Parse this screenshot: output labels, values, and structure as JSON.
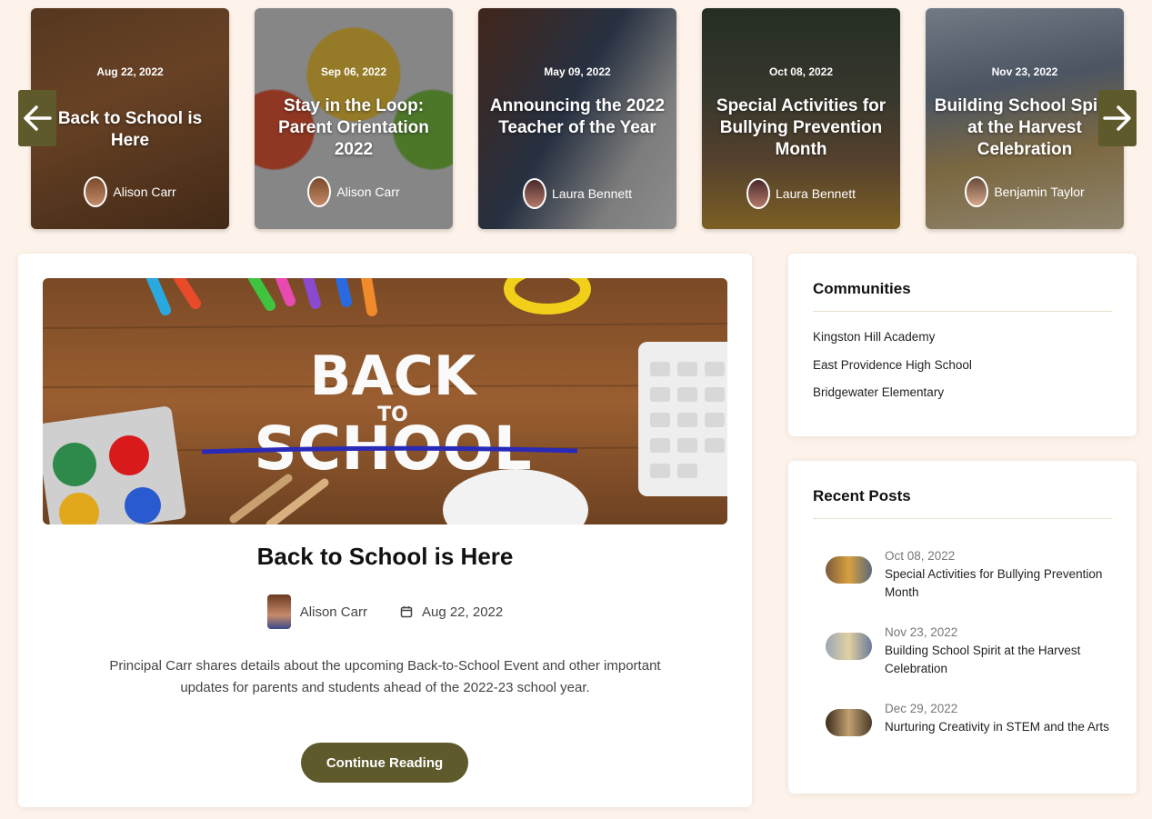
{
  "carousel": {
    "prev_icon": "arrow-left-icon",
    "next_icon": "arrow-right-icon",
    "cards": [
      {
        "date": "Aug 22, 2022",
        "title": "Back to School is Here",
        "author": "Alison Carr"
      },
      {
        "date": "Sep 06, 2022",
        "title": "Stay in the Loop: Parent Orientation 2022",
        "author": "Alison Carr"
      },
      {
        "date": "May 09, 2022",
        "title": "Announcing the 2022 Teacher of the Year",
        "author": "Laura Bennett"
      },
      {
        "date": "Oct 08, 2022",
        "title": "Special Activities for Bullying Prevention Month",
        "author": "Laura Bennett"
      },
      {
        "date": "Nov 23, 2022",
        "title": "Building School Spirit at the Harvest Celebration",
        "author": "Benjamin Taylor"
      }
    ]
  },
  "post": {
    "title": "Back to School is Here",
    "author": "Alison Carr",
    "date": "Aug 22, 2022",
    "excerpt": "Principal Carr shares details about the upcoming Back-to-School Event and other important updates for parents and students ahead of the 2022-23 school year.",
    "button": "Continue Reading",
    "hero_text": {
      "line1": "BACK",
      "line2": "TO",
      "line3": "SCHOOL"
    }
  },
  "communities": {
    "heading": "Communities",
    "items": [
      "Kingston Hill Academy",
      "East Providence High School",
      "Bridgewater Elementary"
    ]
  },
  "recent": {
    "heading": "Recent Posts",
    "items": [
      {
        "date": "Oct 08, 2022",
        "title": "Special Activities for Bullying Prevention Month"
      },
      {
        "date": "Nov 23, 2022",
        "title": "Building School Spirit at the Harvest Celebration"
      },
      {
        "date": "Dec 29, 2022",
        "title": "Nurturing Creativity in STEM and the Arts"
      }
    ]
  },
  "colors": {
    "accent": "#5f5a2c",
    "page_bg": "#fdf3ea"
  }
}
